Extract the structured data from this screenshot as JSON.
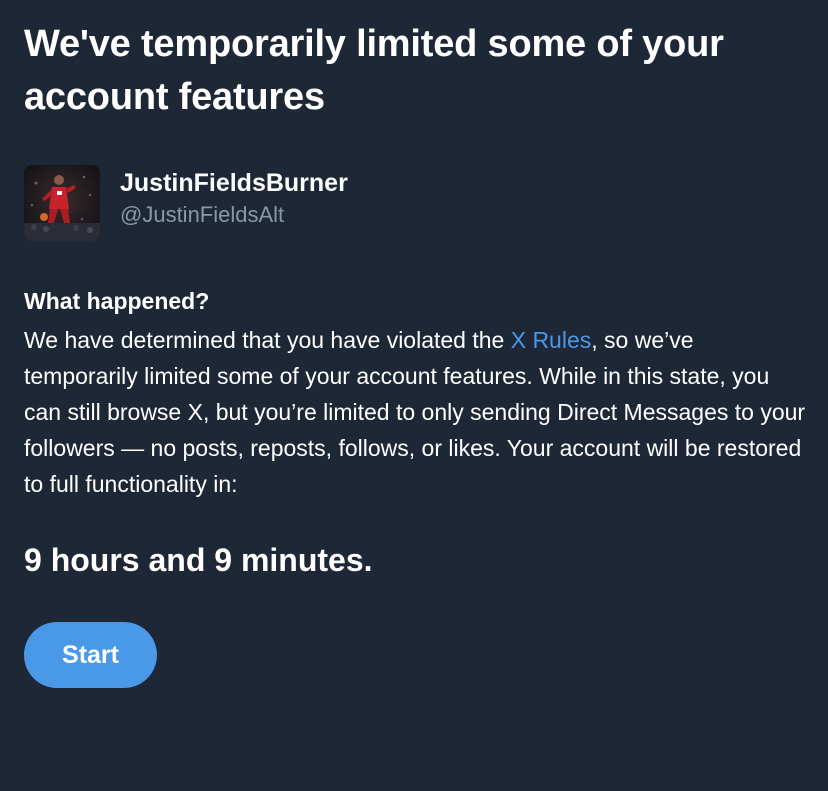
{
  "header": {
    "title": "We've temporarily limited some of your account features"
  },
  "profile": {
    "display_name": "JustinFieldsBurner",
    "handle": "@JustinFieldsAlt",
    "avatar_icon": "profile-photo"
  },
  "notice": {
    "heading": "What happened?",
    "text_before_link": "We have determined that you have violated the ",
    "link_text": "X Rules",
    "text_after_link": ", so we’ve temporarily limited some of your account features. While in this state, you can still browse X, but you’re limited to only sending Direct Messages to your followers — no posts, reposts, follows, or likes. Your account will be restored to full functionality in:",
    "countdown": "9 hours and 9 minutes."
  },
  "actions": {
    "start_label": "Start"
  },
  "colors": {
    "background": "#1e2735",
    "accent": "#4a99e9",
    "secondary_text": "#8899a6"
  }
}
